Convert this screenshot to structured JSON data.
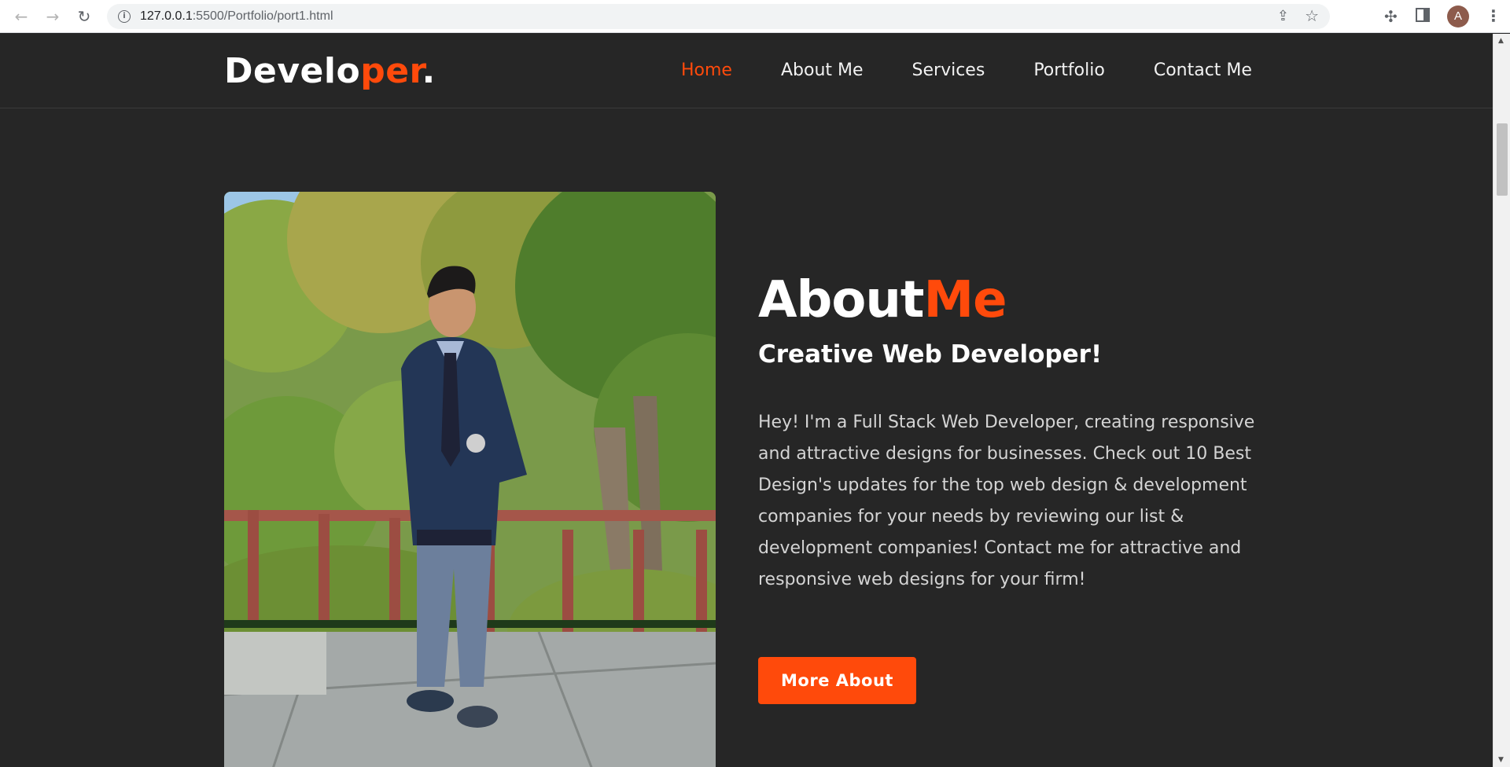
{
  "browser": {
    "url_host": "127.0.0.1",
    "url_rest": ":5500/Portfolio/port1.html",
    "avatar_letter": "A"
  },
  "header": {
    "logo_part1": "Develo",
    "logo_accent": "per",
    "logo_part2": ".",
    "nav": [
      {
        "label": "Home",
        "active": true
      },
      {
        "label": "About Me"
      },
      {
        "label": "Services"
      },
      {
        "label": "Portfolio"
      },
      {
        "label": "Contact Me"
      }
    ]
  },
  "about": {
    "title_part1": "About",
    "title_accent": "Me",
    "subtitle": "Creative Web Developer!",
    "description": "Hey! I'm a Full Stack Web Developer, creating responsive and attractive designs for businesses. Check out 10 Best Design's updates for the top web design & development companies for your needs by reviewing our list & development companies! Contact me for attractive and responsive web designs for your firm!",
    "button_label": "More About"
  },
  "colors": {
    "accent": "#ff4a0b",
    "background": "#262626",
    "text": "#ffffff"
  }
}
